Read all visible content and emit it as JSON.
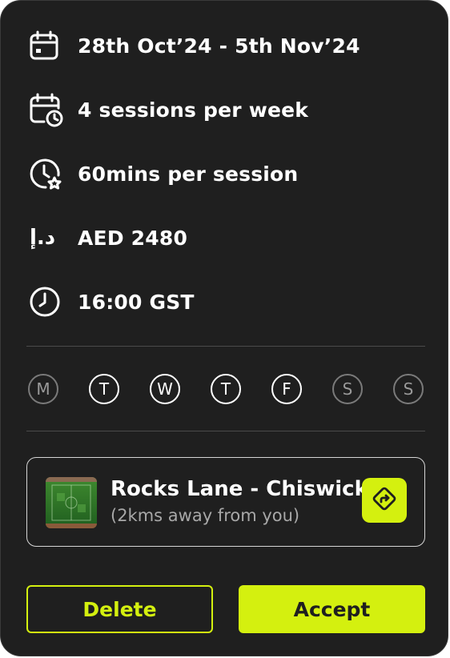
{
  "colors": {
    "background": "#1f1f1f",
    "accent": "#d4f00f",
    "text": "#ffffff",
    "muted": "#a8a8a8",
    "divider": "#4a4a4a"
  },
  "details": {
    "date_range": "28th Oct’24 - 5th Nov’24",
    "frequency": "4 sessions per week",
    "duration": "60mins per session",
    "currency_symbol": "د.إ",
    "price": "AED 2480",
    "time": "16:00 GST"
  },
  "icons": {
    "date_range": "calendar-icon",
    "frequency": "calendar-clock-icon",
    "duration": "clock-star-icon",
    "price": "dirham-currency-icon",
    "time": "clock-icon",
    "directions": "directions-icon"
  },
  "days": [
    {
      "label": "M",
      "selected": false
    },
    {
      "label": "T",
      "selected": true
    },
    {
      "label": "W",
      "selected": true
    },
    {
      "label": "T",
      "selected": true
    },
    {
      "label": "F",
      "selected": true
    },
    {
      "label": "S",
      "selected": false
    },
    {
      "label": "S",
      "selected": false
    }
  ],
  "location": {
    "name": "Rocks Lane - Chiswick",
    "distance": "(2kms away from you)"
  },
  "actions": {
    "delete_label": "Delete",
    "accept_label": "Accept"
  }
}
